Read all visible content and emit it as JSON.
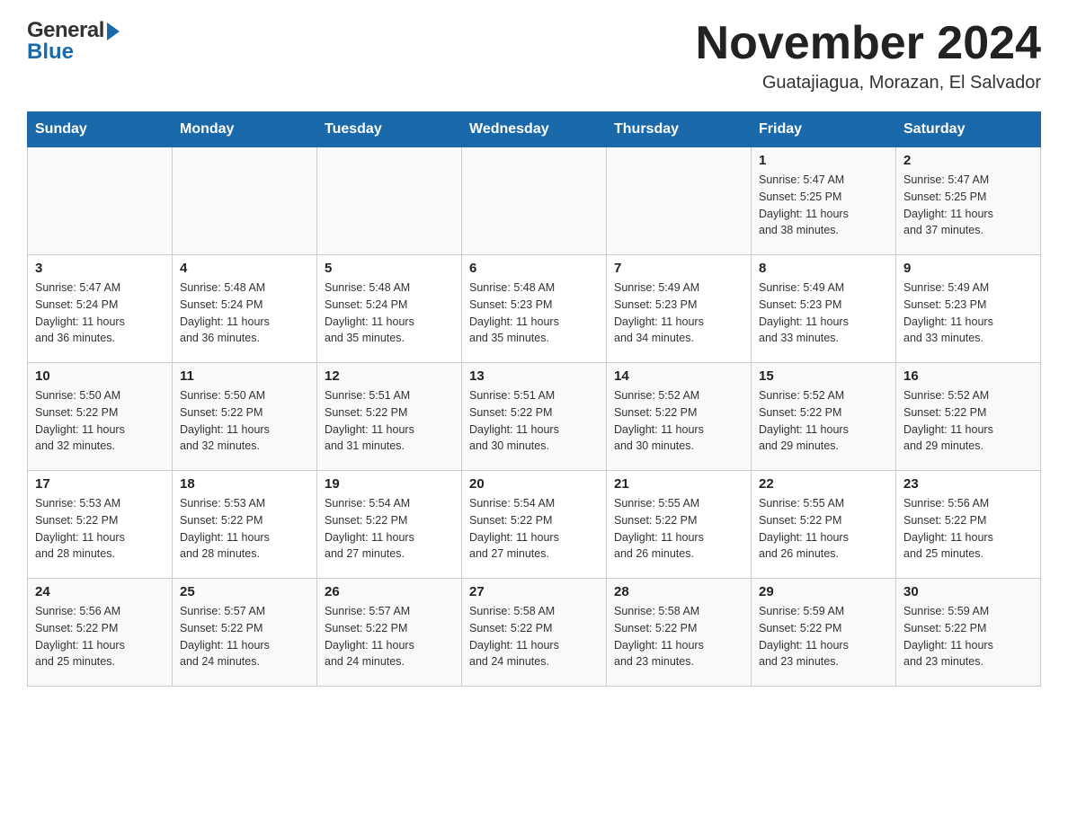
{
  "header": {
    "logo_general": "General",
    "logo_blue": "Blue",
    "month_title": "November 2024",
    "location": "Guatajiagua, Morazan, El Salvador"
  },
  "calendar": {
    "days_of_week": [
      "Sunday",
      "Monday",
      "Tuesday",
      "Wednesday",
      "Thursday",
      "Friday",
      "Saturday"
    ],
    "weeks": [
      [
        {
          "day": "",
          "info": ""
        },
        {
          "day": "",
          "info": ""
        },
        {
          "day": "",
          "info": ""
        },
        {
          "day": "",
          "info": ""
        },
        {
          "day": "",
          "info": ""
        },
        {
          "day": "1",
          "info": "Sunrise: 5:47 AM\nSunset: 5:25 PM\nDaylight: 11 hours\nand 38 minutes."
        },
        {
          "day": "2",
          "info": "Sunrise: 5:47 AM\nSunset: 5:25 PM\nDaylight: 11 hours\nand 37 minutes."
        }
      ],
      [
        {
          "day": "3",
          "info": "Sunrise: 5:47 AM\nSunset: 5:24 PM\nDaylight: 11 hours\nand 36 minutes."
        },
        {
          "day": "4",
          "info": "Sunrise: 5:48 AM\nSunset: 5:24 PM\nDaylight: 11 hours\nand 36 minutes."
        },
        {
          "day": "5",
          "info": "Sunrise: 5:48 AM\nSunset: 5:24 PM\nDaylight: 11 hours\nand 35 minutes."
        },
        {
          "day": "6",
          "info": "Sunrise: 5:48 AM\nSunset: 5:23 PM\nDaylight: 11 hours\nand 35 minutes."
        },
        {
          "day": "7",
          "info": "Sunrise: 5:49 AM\nSunset: 5:23 PM\nDaylight: 11 hours\nand 34 minutes."
        },
        {
          "day": "8",
          "info": "Sunrise: 5:49 AM\nSunset: 5:23 PM\nDaylight: 11 hours\nand 33 minutes."
        },
        {
          "day": "9",
          "info": "Sunrise: 5:49 AM\nSunset: 5:23 PM\nDaylight: 11 hours\nand 33 minutes."
        }
      ],
      [
        {
          "day": "10",
          "info": "Sunrise: 5:50 AM\nSunset: 5:22 PM\nDaylight: 11 hours\nand 32 minutes."
        },
        {
          "day": "11",
          "info": "Sunrise: 5:50 AM\nSunset: 5:22 PM\nDaylight: 11 hours\nand 32 minutes."
        },
        {
          "day": "12",
          "info": "Sunrise: 5:51 AM\nSunset: 5:22 PM\nDaylight: 11 hours\nand 31 minutes."
        },
        {
          "day": "13",
          "info": "Sunrise: 5:51 AM\nSunset: 5:22 PM\nDaylight: 11 hours\nand 30 minutes."
        },
        {
          "day": "14",
          "info": "Sunrise: 5:52 AM\nSunset: 5:22 PM\nDaylight: 11 hours\nand 30 minutes."
        },
        {
          "day": "15",
          "info": "Sunrise: 5:52 AM\nSunset: 5:22 PM\nDaylight: 11 hours\nand 29 minutes."
        },
        {
          "day": "16",
          "info": "Sunrise: 5:52 AM\nSunset: 5:22 PM\nDaylight: 11 hours\nand 29 minutes."
        }
      ],
      [
        {
          "day": "17",
          "info": "Sunrise: 5:53 AM\nSunset: 5:22 PM\nDaylight: 11 hours\nand 28 minutes."
        },
        {
          "day": "18",
          "info": "Sunrise: 5:53 AM\nSunset: 5:22 PM\nDaylight: 11 hours\nand 28 minutes."
        },
        {
          "day": "19",
          "info": "Sunrise: 5:54 AM\nSunset: 5:22 PM\nDaylight: 11 hours\nand 27 minutes."
        },
        {
          "day": "20",
          "info": "Sunrise: 5:54 AM\nSunset: 5:22 PM\nDaylight: 11 hours\nand 27 minutes."
        },
        {
          "day": "21",
          "info": "Sunrise: 5:55 AM\nSunset: 5:22 PM\nDaylight: 11 hours\nand 26 minutes."
        },
        {
          "day": "22",
          "info": "Sunrise: 5:55 AM\nSunset: 5:22 PM\nDaylight: 11 hours\nand 26 minutes."
        },
        {
          "day": "23",
          "info": "Sunrise: 5:56 AM\nSunset: 5:22 PM\nDaylight: 11 hours\nand 25 minutes."
        }
      ],
      [
        {
          "day": "24",
          "info": "Sunrise: 5:56 AM\nSunset: 5:22 PM\nDaylight: 11 hours\nand 25 minutes."
        },
        {
          "day": "25",
          "info": "Sunrise: 5:57 AM\nSunset: 5:22 PM\nDaylight: 11 hours\nand 24 minutes."
        },
        {
          "day": "26",
          "info": "Sunrise: 5:57 AM\nSunset: 5:22 PM\nDaylight: 11 hours\nand 24 minutes."
        },
        {
          "day": "27",
          "info": "Sunrise: 5:58 AM\nSunset: 5:22 PM\nDaylight: 11 hours\nand 24 minutes."
        },
        {
          "day": "28",
          "info": "Sunrise: 5:58 AM\nSunset: 5:22 PM\nDaylight: 11 hours\nand 23 minutes."
        },
        {
          "day": "29",
          "info": "Sunrise: 5:59 AM\nSunset: 5:22 PM\nDaylight: 11 hours\nand 23 minutes."
        },
        {
          "day": "30",
          "info": "Sunrise: 5:59 AM\nSunset: 5:22 PM\nDaylight: 11 hours\nand 23 minutes."
        }
      ]
    ]
  }
}
